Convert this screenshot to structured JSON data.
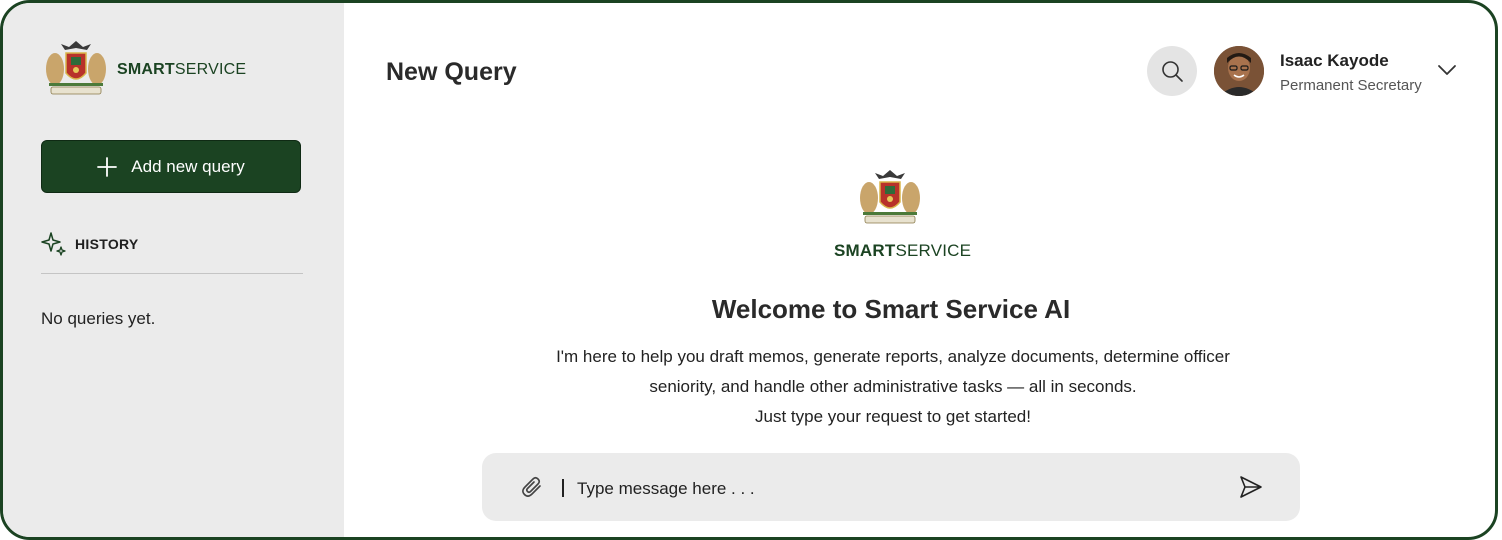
{
  "brand": {
    "part1": "SMART",
    "part2": "SERVICE"
  },
  "sidebar": {
    "add_label": "Add new query",
    "history_label": "HISTORY",
    "empty_label": "No queries yet."
  },
  "header": {
    "title": "New Query",
    "user_name": "Isaac Kayode",
    "user_role": "Permanent Secretary"
  },
  "welcome": {
    "title": "Welcome to Smart Service AI",
    "line1": "I'm here to help you draft memos, generate reports, analyze documents, determine officer",
    "line2": "seniority, and handle other administrative tasks — all in seconds.",
    "line3": "Just type your request to get started!"
  },
  "composer": {
    "placeholder": "Type message here . . ."
  },
  "icons": {
    "search": "search-icon",
    "chevron": "chevron-down-icon",
    "attach": "paperclip-icon",
    "send": "send-icon",
    "history": "sparkle-icon",
    "add": "plus-icon"
  },
  "colors": {
    "brand_green": "#1b4322",
    "sidebar_bg": "#ebebeb",
    "input_bg": "#ebebeb"
  }
}
